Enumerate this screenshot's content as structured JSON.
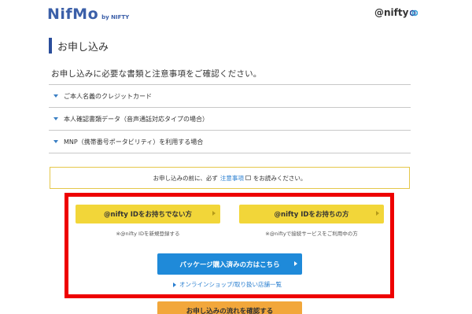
{
  "header": {
    "logo_main": "NifMo",
    "logo_by": "by NIFTY",
    "partner_logo": "@nifty",
    "colors": {
      "brand": "#3b5fa8",
      "accent": "#2a4d9b"
    }
  },
  "page": {
    "title": "お申し込み",
    "intro": "お申し込みに必要な書類と注意事項をご確認ください。"
  },
  "documents": [
    {
      "label": "ご本人名義のクレジットカード"
    },
    {
      "label": "本人確認書類データ（音声通話対応タイプの場合）"
    },
    {
      "label": "MNP（携帯番号ポータビリティ）を利用する場合"
    }
  ],
  "notice": {
    "before": "お申し込みの前に、必ず",
    "link": "注意事項",
    "after": "をお読みください。"
  },
  "actions": {
    "no_id_button": "@nifty IDをお持ちでない方",
    "no_id_note": "※@nifty IDを新規登録する",
    "has_id_button": "@nifty IDをお持ちの方",
    "has_id_note": "※@niftyで接続サービスをご利用中の方",
    "package_button": "パッケージ購入済みの方はこちら",
    "shop_link": "オンラインショップ/取り扱い店舗一覧",
    "flow_button": "お申し込みの流れを確認する"
  },
  "colors": {
    "yellow_button": "#f2d639",
    "blue_button": "#1f8ad9",
    "orange_button": "#f2a73b",
    "highlight_frame": "#ee0000",
    "link": "#2a7fd0"
  }
}
